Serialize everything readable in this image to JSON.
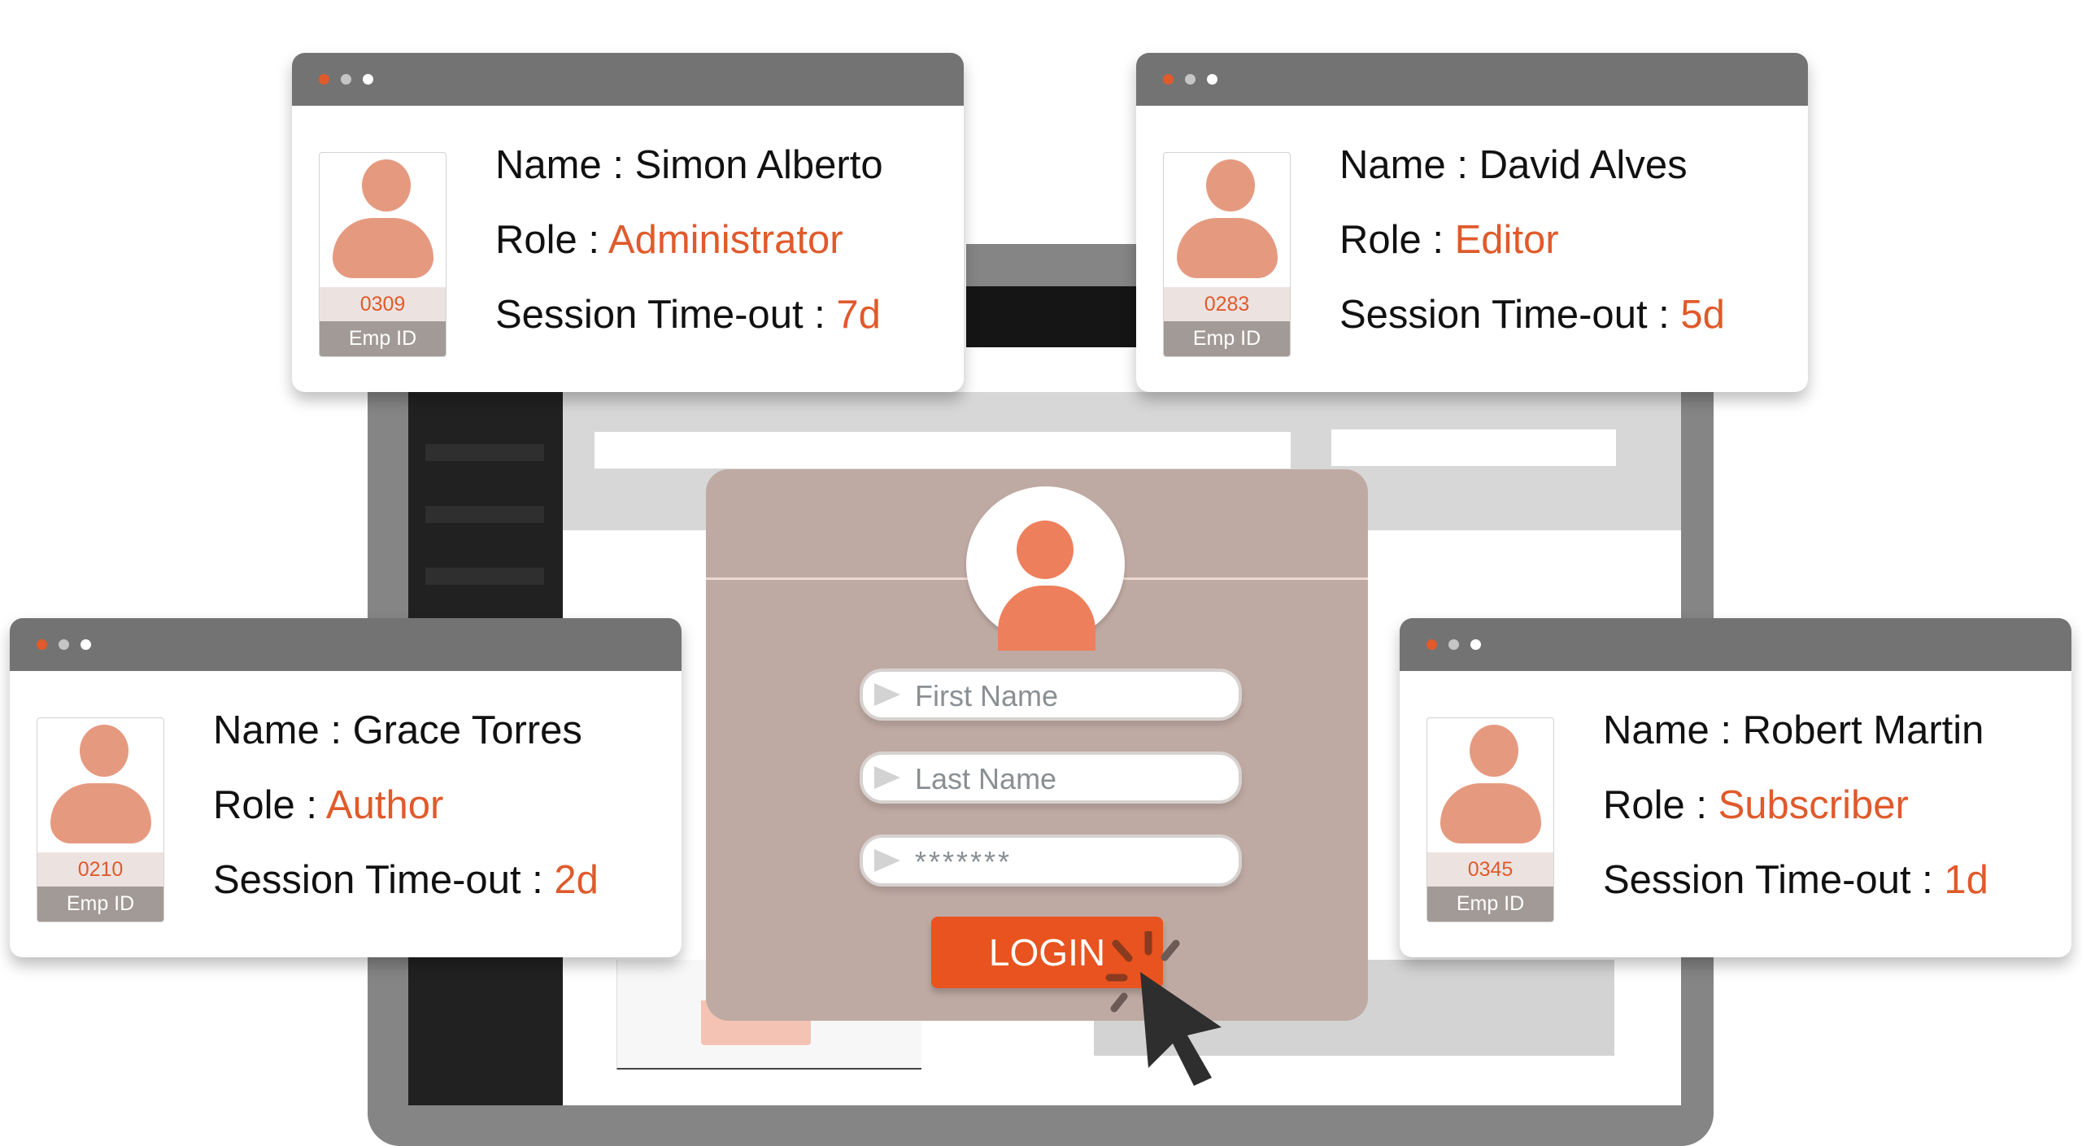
{
  "cards": [
    {
      "name_label": "Name : ",
      "name": "Simon Alberto",
      "role_label": "Role : ",
      "role": "Administrator",
      "timeout_label": "Session Time-out : ",
      "timeout": "7d",
      "emp_id": "0309",
      "emp_id_label": "Emp ID"
    },
    {
      "name_label": "Name : ",
      "name": "David Alves",
      "role_label": "Role : ",
      "role": "Editor",
      "timeout_label": "Session Time-out : ",
      "timeout": "5d",
      "emp_id": "0283",
      "emp_id_label": "Emp ID"
    },
    {
      "name_label": "Name : ",
      "name": "Grace Torres",
      "role_label": "Role : ",
      "role": "Author",
      "timeout_label": "Session Time-out : ",
      "timeout": "2d",
      "emp_id": "0210",
      "emp_id_label": "Emp ID"
    },
    {
      "name_label": "Name : ",
      "name": "Robert Martin",
      "role_label": "Role : ",
      "role": "Subscriber",
      "timeout_label": "Session Time-out : ",
      "timeout": "1d",
      "emp_id": "0345",
      "emp_id_label": "Emp ID"
    }
  ],
  "login": {
    "first_name_placeholder": "First Name",
    "last_name_placeholder": "Last Name",
    "password_value": "*******",
    "button_label": "LOGIN"
  },
  "colors": {
    "accent": "#e05a2b",
    "button": "#e8531f",
    "panel": "#bfaaa3",
    "titlebar": "#737373"
  },
  "icons": {
    "avatar": "user-avatar-icon",
    "field_arrow": "arrow-right-icon",
    "cursor": "mouse-pointer-icon"
  }
}
